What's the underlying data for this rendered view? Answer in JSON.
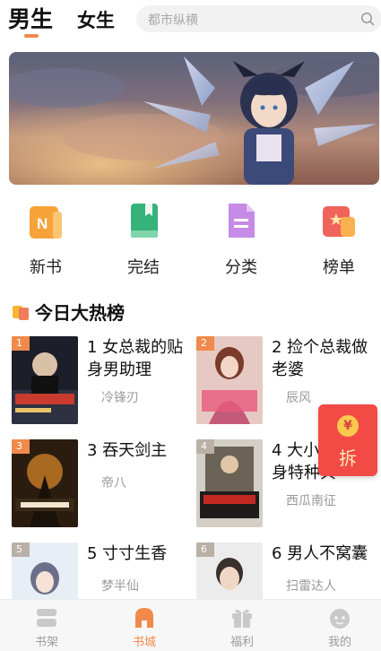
{
  "header": {
    "tabs": [
      {
        "label": "男生",
        "active": true
      },
      {
        "label": "女生",
        "active": false
      }
    ],
    "search": {
      "placeholder": "都市纵横"
    }
  },
  "categories": [
    {
      "label": "新书",
      "icon": "new-book-icon",
      "color": "#f7a33a"
    },
    {
      "label": "完结",
      "icon": "finished-book-icon",
      "color": "#35b37a"
    },
    {
      "label": "分类",
      "icon": "category-doc-icon",
      "color": "#b873e0"
    },
    {
      "label": "榜单",
      "icon": "ranking-icon",
      "color": "#f0635b"
    }
  ],
  "hot_section": {
    "title": "今日大热榜"
  },
  "books": [
    {
      "rank": "1",
      "title": "1 女总裁的贴身男助理",
      "author": "冷锋刃",
      "badge_color": "#f08a4b"
    },
    {
      "rank": "2",
      "title": "2 捡个总裁做老婆",
      "author": "辰风",
      "badge_color": "#f08a4b"
    },
    {
      "rank": "3",
      "title": "3 吞天剑主",
      "author": "帝八",
      "badge_color": "#f08a4b"
    },
    {
      "rank": "4",
      "title": "4 大小姐的贴身特种兵",
      "author": "西瓜南征",
      "badge_color": "#b9b0a6"
    },
    {
      "rank": "5",
      "title": "5 寸寸生香",
      "author": "梦半仙",
      "badge_color": "#b9b0a6"
    },
    {
      "rank": "6",
      "title": "6 男人不窝囊",
      "author": "扫雷达人",
      "badge_color": "#b9b0a6"
    }
  ],
  "red_packet": {
    "coin": "¥",
    "label": "拆"
  },
  "bottom_nav": [
    {
      "label": "书架",
      "icon": "bookshelf-icon",
      "active": false
    },
    {
      "label": "书城",
      "icon": "bookstore-icon",
      "active": true
    },
    {
      "label": "福利",
      "icon": "gift-icon",
      "active": false
    },
    {
      "label": "我的",
      "icon": "profile-icon",
      "active": false
    }
  ],
  "colors": {
    "accent": "#f08a4b",
    "muted": "#9b9b9b"
  }
}
